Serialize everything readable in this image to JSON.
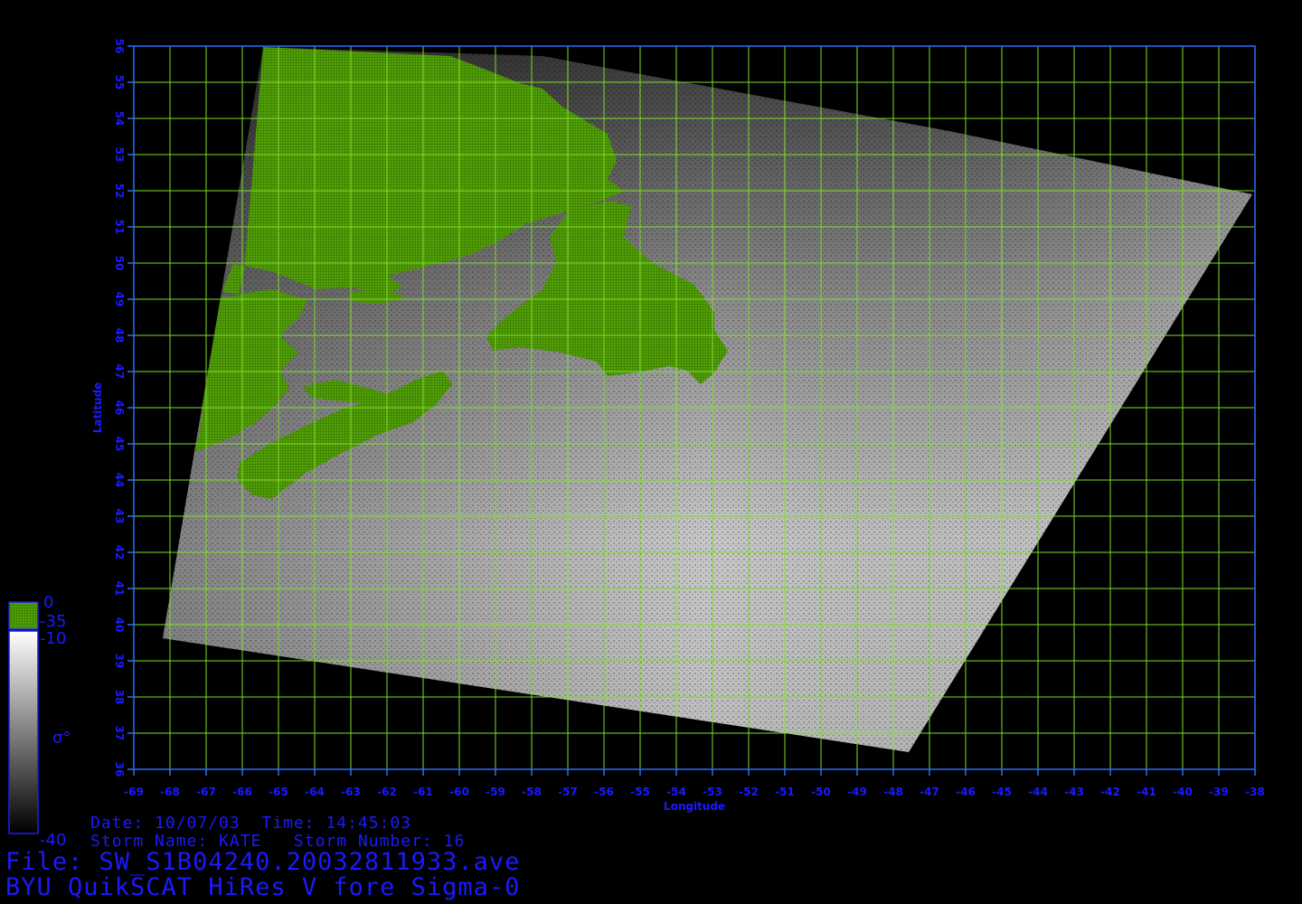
{
  "map": {
    "x_axis_title": "Longitude",
    "y_axis_title": "Latitude",
    "lon_ticks": [
      "-69",
      "-68",
      "-67",
      "-66",
      "-65",
      "-64",
      "-63",
      "-62",
      "-61",
      "-60",
      "-59",
      "-58",
      "-57",
      "-56",
      "-55",
      "-54",
      "-53",
      "-52",
      "-51",
      "-50",
      "-49",
      "-48",
      "-47",
      "-46",
      "-45",
      "-44",
      "-43",
      "-42",
      "-41",
      "-40",
      "-39",
      "-38"
    ],
    "lat_ticks": [
      "36",
      "37",
      "38",
      "39",
      "40",
      "41",
      "42",
      "43",
      "44",
      "45",
      "46",
      "47",
      "48",
      "49",
      "50",
      "51",
      "52",
      "53",
      "54",
      "55",
      "56"
    ],
    "lon_range": [
      -69,
      -38
    ],
    "lat_range": [
      36,
      56
    ],
    "grid": true,
    "colors": {
      "frame": "#2a6cff",
      "grid": "#7ddc2a",
      "land": "#4e9a06",
      "text": "#1a1aff"
    }
  },
  "legend": {
    "land_top": "0",
    "land_bottom": "-35",
    "sea_top": "-10",
    "sea_bottom": "-40",
    "symbol": "σ°",
    "land_color": "#4e9a06",
    "sea_colors": [
      "#ffffff",
      "#000000"
    ]
  },
  "info": {
    "date_line": "Date: 10/07/03  Time: 14:45:03",
    "storm_line": "Storm Name: KATE   Storm Number: 16",
    "file_line": "File: SW_S1B04240.20032811933.ave",
    "title_line": "BYU QuikSCAT HiRes V fore Sigma-0"
  }
}
